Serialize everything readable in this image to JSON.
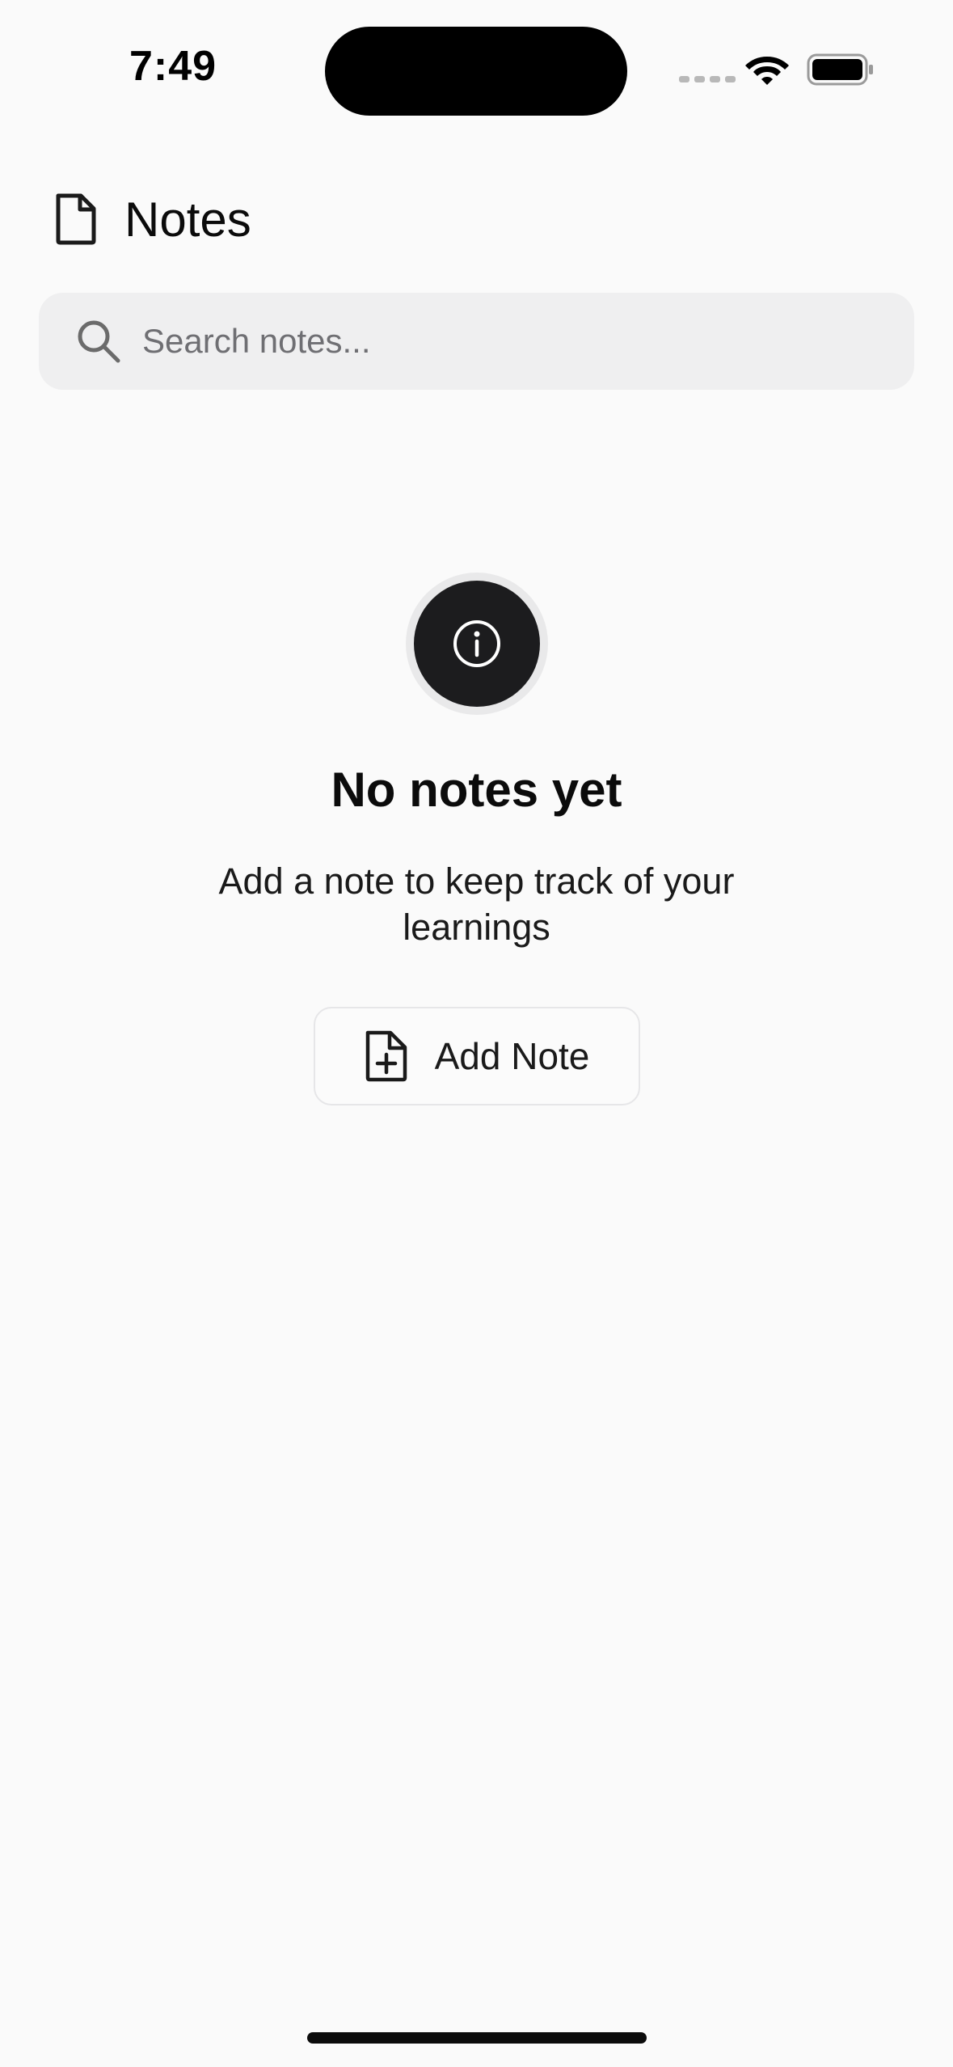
{
  "status_bar": {
    "time": "7:49",
    "icons": [
      "signal-dots-icon",
      "wifi-icon",
      "battery-icon"
    ]
  },
  "header": {
    "icon": "document-icon",
    "title": "Notes"
  },
  "search": {
    "icon": "search-icon",
    "placeholder": "Search notes...",
    "value": ""
  },
  "empty_state": {
    "icon": "info-icon",
    "title": "No notes yet",
    "message": "Add a note to keep track of your learnings",
    "button": {
      "icon": "document-plus-icon",
      "label": "Add Note"
    }
  },
  "colors": {
    "background": "#fafafa",
    "search_bg": "#efeff0",
    "badge_dark": "#1c1c1e",
    "text": "#0b0b0b"
  }
}
